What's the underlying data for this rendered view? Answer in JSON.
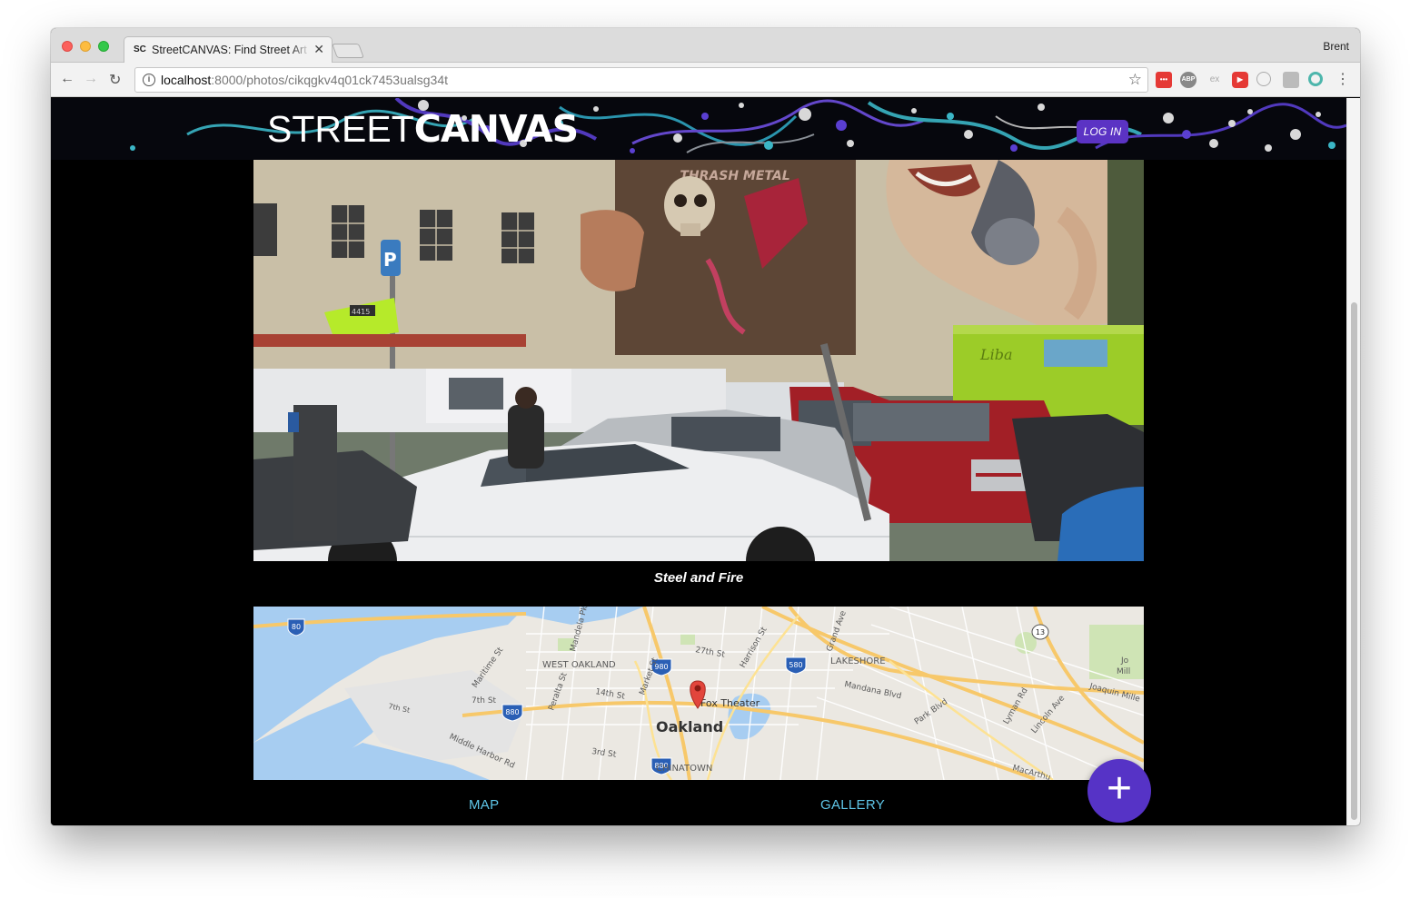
{
  "browser": {
    "tab_favicon": "SC",
    "tab_title": "StreetCANVAS: Find Street Art",
    "tab_close": "✕",
    "profile_name": "Brent",
    "url_host": "localhost",
    "url_path": ":8000/photos/cikqgkv4q01ck7453ualsg34t",
    "nav_back_icon": "←",
    "nav_forward_icon": "→",
    "nav_reload_icon": "↻",
    "star_icon": "☆",
    "menu_icon": "⋮",
    "extensions": [
      "•••",
      "ABP",
      "ex",
      "▶",
      "",
      "",
      ""
    ]
  },
  "header": {
    "logo_thin": "STREET",
    "logo_bold": "CANVAS",
    "login_label": "LOG IN",
    "accent_color": "#5b33c4"
  },
  "photo": {
    "caption": "Steel and Fire",
    "mural_text": "THRASH METAL",
    "sign_number": "4415"
  },
  "map": {
    "labels": {
      "west_oakland": "WEST OAKLAND",
      "lakeshore": "LAKESHORE",
      "oakland": "Oakland",
      "chinatown": "CHINATOWN",
      "fox_theater": "Fox Theater",
      "s27th": "27th St",
      "s14th": "14th St",
      "s7th": "7th St",
      "s7th_b": "7th St",
      "s3rd": "3rd St",
      "harrison": "Harrison St",
      "grand": "Grand Ave",
      "mandana": "Mandana Blvd",
      "park": "Park Blvd",
      "lincoln": "Lincoln Ave",
      "lyman": "Lyman Rd",
      "joaquin": "Joaquin Mille",
      "middle_harbor": "Middle Harbor Rd",
      "market": "Market St",
      "peralta": "Peralta St",
      "maritime": "Maritime St",
      "mandela": "Mandela Pkwy",
      "macarthur": "MacArthu",
      "jo": "Jo",
      "mill": "Mill"
    },
    "shields": {
      "i80": "80",
      "i880a": "880",
      "i880b": "880",
      "i980": "980",
      "i580": "580",
      "ca13": "13"
    }
  },
  "footer": {
    "map_label": "MAP",
    "gallery_label": "GALLERY",
    "fab_label": "+",
    "link_color": "#5fc6e8"
  }
}
